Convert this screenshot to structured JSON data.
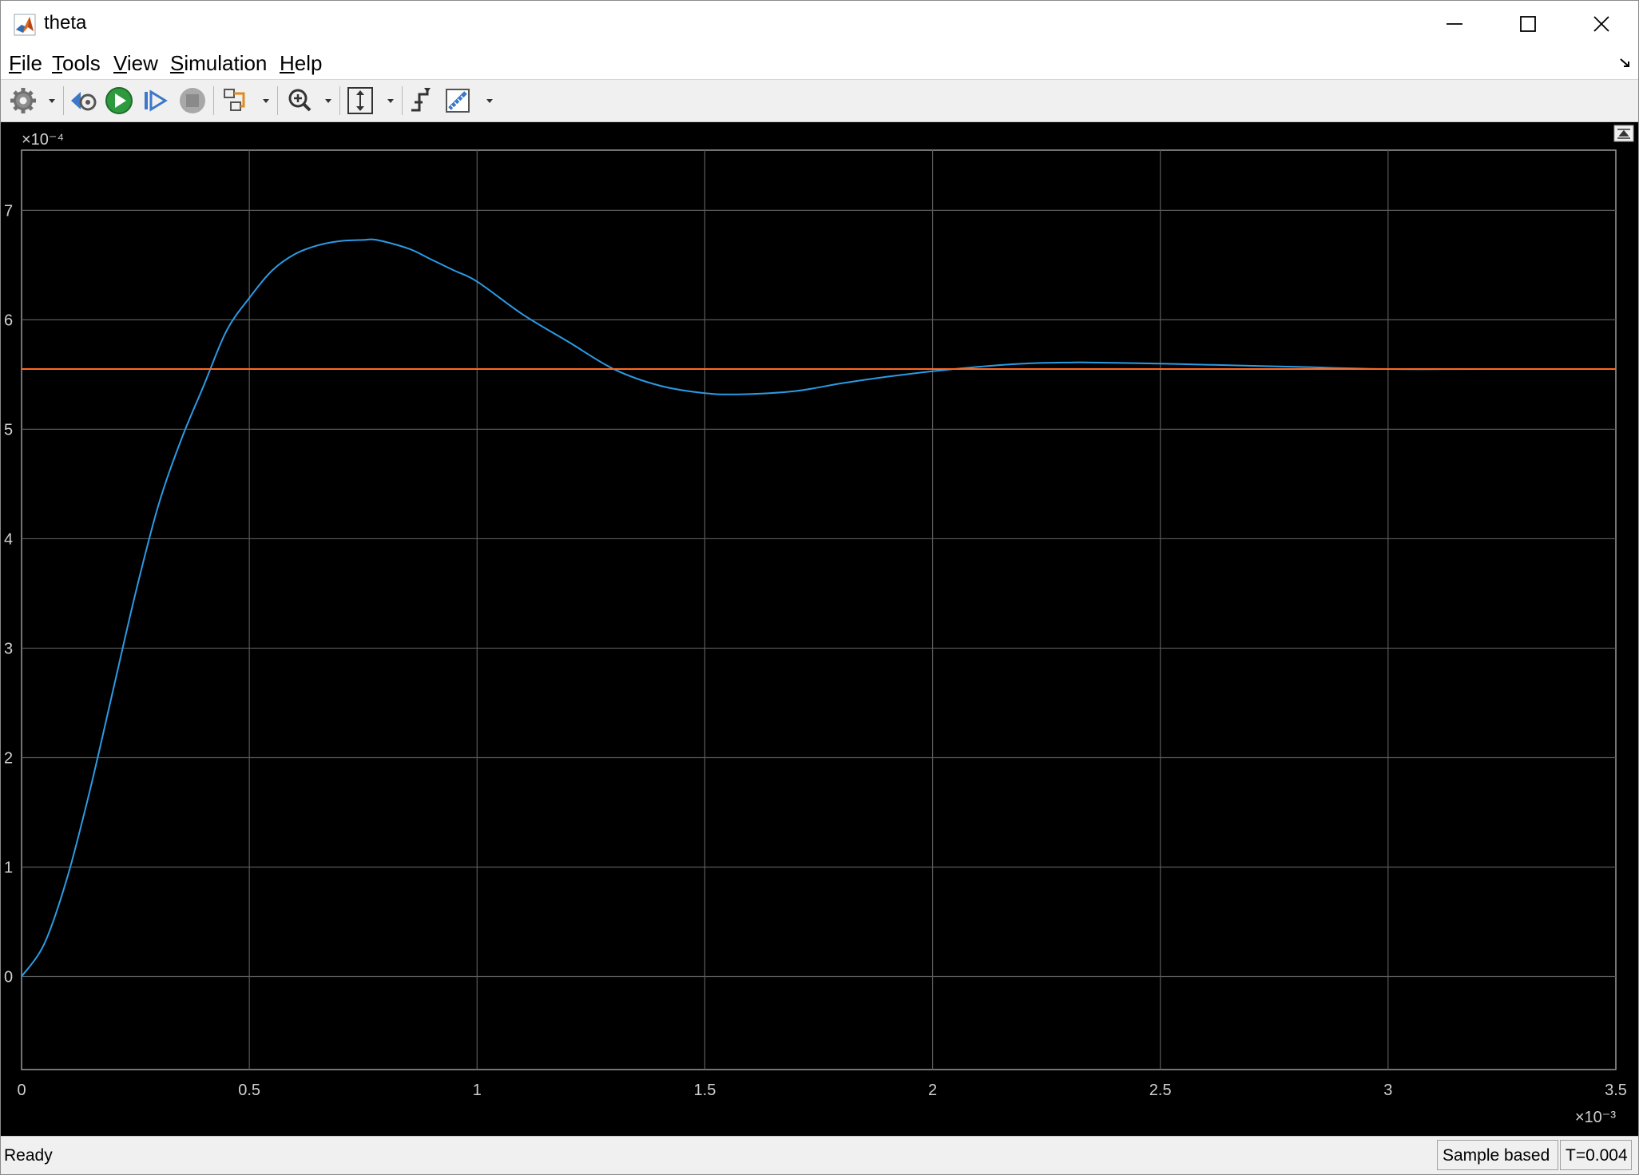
{
  "window": {
    "title": "theta"
  },
  "menu": {
    "items": [
      "File",
      "Tools",
      "View",
      "Simulation",
      "Help"
    ]
  },
  "toolbar": {
    "icons": [
      "gear-icon",
      "step-back-icon",
      "run-icon",
      "step-forward-icon",
      "stop-icon",
      "signal-config-icon",
      "zoom-icon",
      "scale-axes-icon",
      "triggers-icon",
      "measurements-icon"
    ]
  },
  "colors": {
    "plot_background": "#000000",
    "grid": "#5a5a5a",
    "series_response": "#2b9be6",
    "series_reference": "#ff6a20"
  },
  "status": {
    "ready": "Ready",
    "mode": "Sample based",
    "time": "T=0.004"
  },
  "chart_data": {
    "type": "line",
    "title": "",
    "xlabel": "",
    "ylabel": "",
    "x_exponent_label": "×10⁻³",
    "y_exponent_label": "×10⁻⁴",
    "xlim": [
      0,
      3.5
    ],
    "ylim": [
      -0.85,
      7.55
    ],
    "grid": true,
    "x_ticks": [
      "0",
      "0.5",
      "1",
      "1.5",
      "2",
      "2.5",
      "3",
      "3.5"
    ],
    "y_ticks": [
      "0",
      "1",
      "2",
      "3",
      "4",
      "5",
      "6",
      "7"
    ],
    "series": [
      {
        "x": [
          0,
          0.05,
          0.1,
          0.15,
          0.2,
          0.25,
          0.3,
          0.35,
          0.4,
          0.45,
          0.5,
          0.55,
          0.6,
          0.65,
          0.7,
          0.75,
          0.78,
          0.85,
          0.9,
          0.95,
          1.0,
          1.1,
          1.2,
          1.3,
          1.4,
          1.5,
          1.58,
          1.7,
          1.8,
          1.9,
          2.0,
          2.1,
          2.2,
          2.3,
          2.35,
          2.5,
          2.6,
          2.8,
          3.0,
          3.2,
          3.5
        ],
        "values": [
          0,
          0.3,
          0.9,
          1.7,
          2.6,
          3.5,
          4.3,
          4.9,
          5.4,
          5.9,
          6.2,
          6.45,
          6.6,
          6.68,
          6.72,
          6.73,
          6.73,
          6.65,
          6.55,
          6.45,
          6.35,
          6.05,
          5.8,
          5.55,
          5.4,
          5.33,
          5.32,
          5.35,
          5.42,
          5.48,
          5.53,
          5.57,
          5.6,
          5.61,
          5.61,
          5.6,
          5.59,
          5.57,
          5.55,
          5.55,
          5.55
        ]
      },
      {
        "x": [
          0,
          3.5
        ],
        "values": [
          5.55,
          5.55
        ]
      }
    ]
  }
}
